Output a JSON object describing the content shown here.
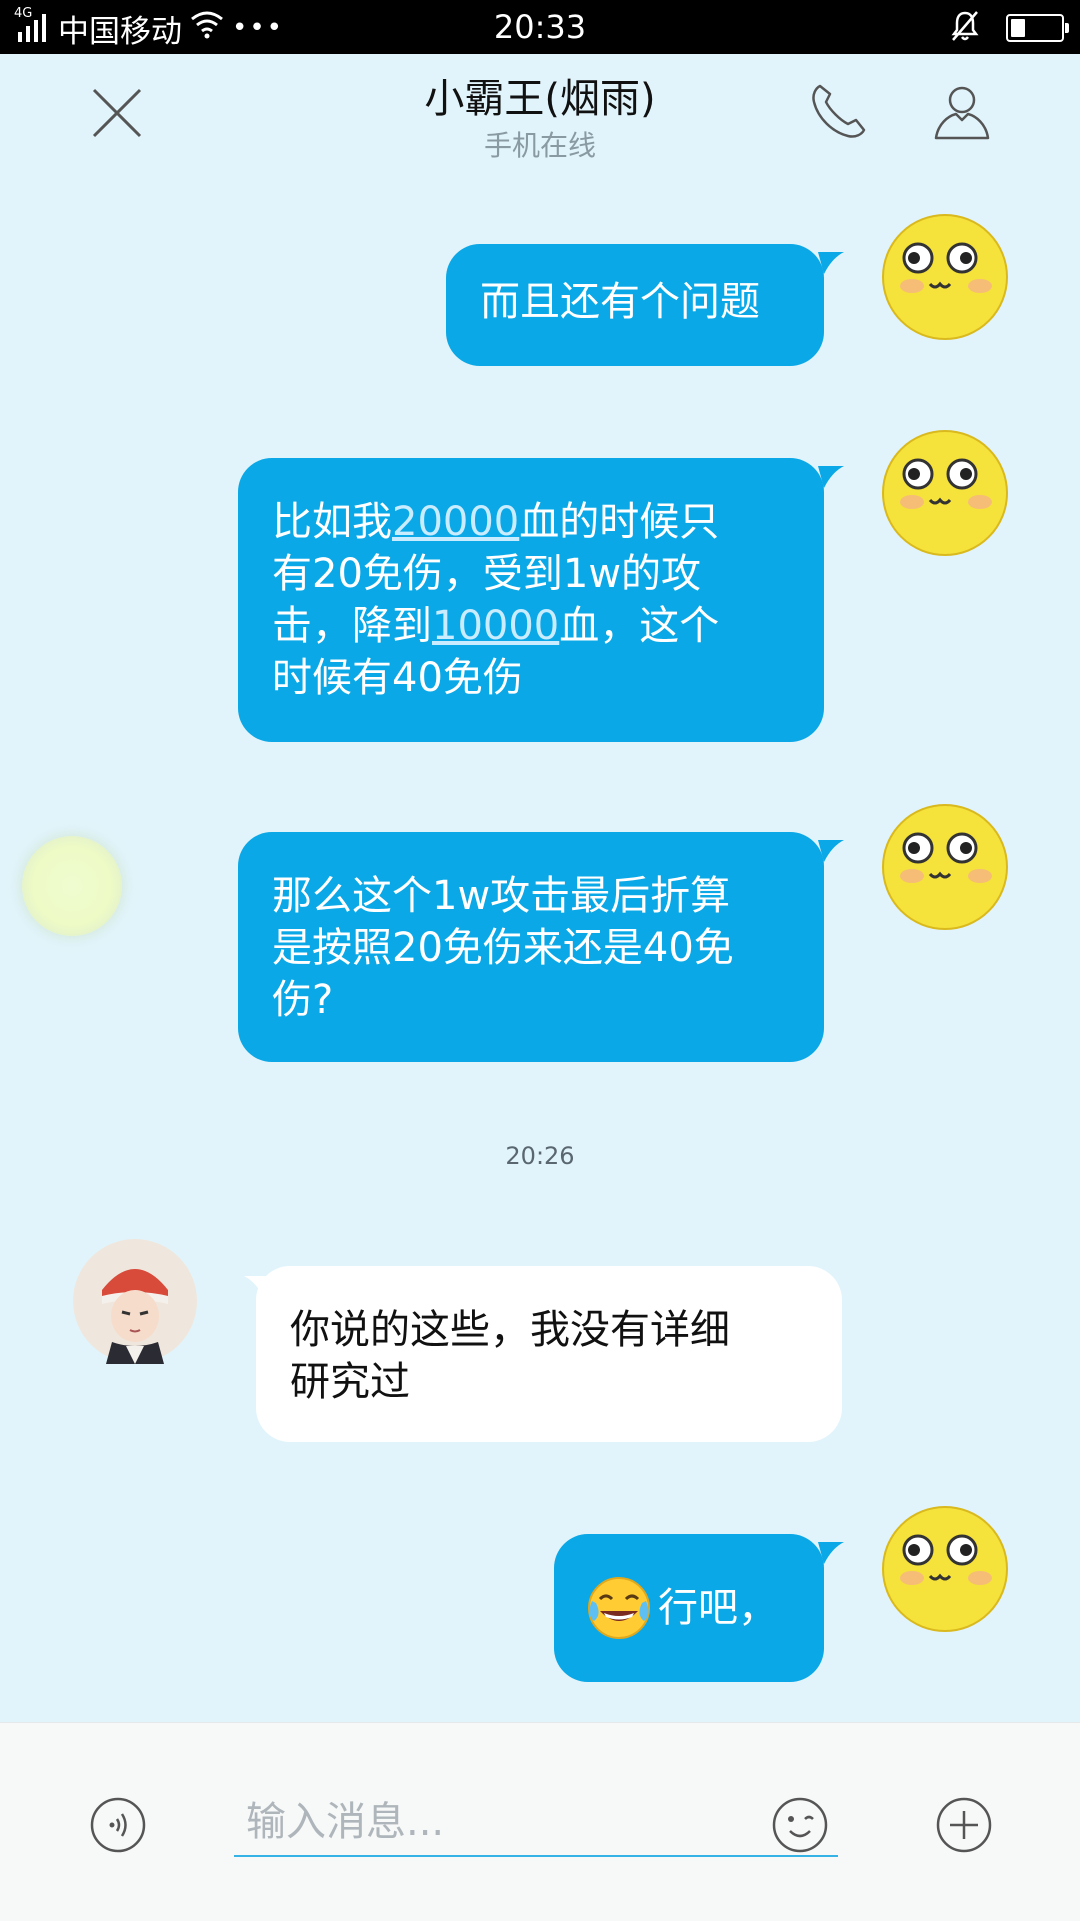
{
  "status_bar": {
    "network": "4G",
    "carrier": "中国移动",
    "dots": "•••",
    "time": "20:33",
    "battery_level": 0.3
  },
  "header": {
    "title": "小霸王(烟雨)",
    "subtitle": "手机在线"
  },
  "messages": [
    {
      "from": "me",
      "text": "而且还有个问题"
    },
    {
      "from": "me",
      "lines": [
        [
          {
            "t": "比如我"
          },
          {
            "t": "20000",
            "link": true
          },
          {
            "t": "血的时候只"
          }
        ],
        [
          {
            "t": "有20免伤，受到1w的攻"
          }
        ],
        [
          {
            "t": "击，降到"
          },
          {
            "t": "10000",
            "link": true
          },
          {
            "t": "血，这个"
          }
        ],
        [
          {
            "t": "时候有40免伤"
          }
        ]
      ]
    },
    {
      "from": "me",
      "lines_plain": [
        "那么这个1w攻击最后折算",
        "是按照20免伤来还是40免",
        "伤?"
      ]
    },
    {
      "from": "them",
      "lines_plain": [
        "你说的这些，我没有详细",
        "研究过"
      ]
    },
    {
      "from": "me",
      "emoji": "face-with-tears-of-joy",
      "text": "行吧，"
    }
  ],
  "timestamp": "20:26",
  "input": {
    "placeholder": "输入消息..."
  },
  "colors": {
    "background": "#e1f4fb",
    "bubble_out": "#0aa8e6",
    "bubble_in": "#ffffff",
    "accent": "#36b3e6"
  }
}
